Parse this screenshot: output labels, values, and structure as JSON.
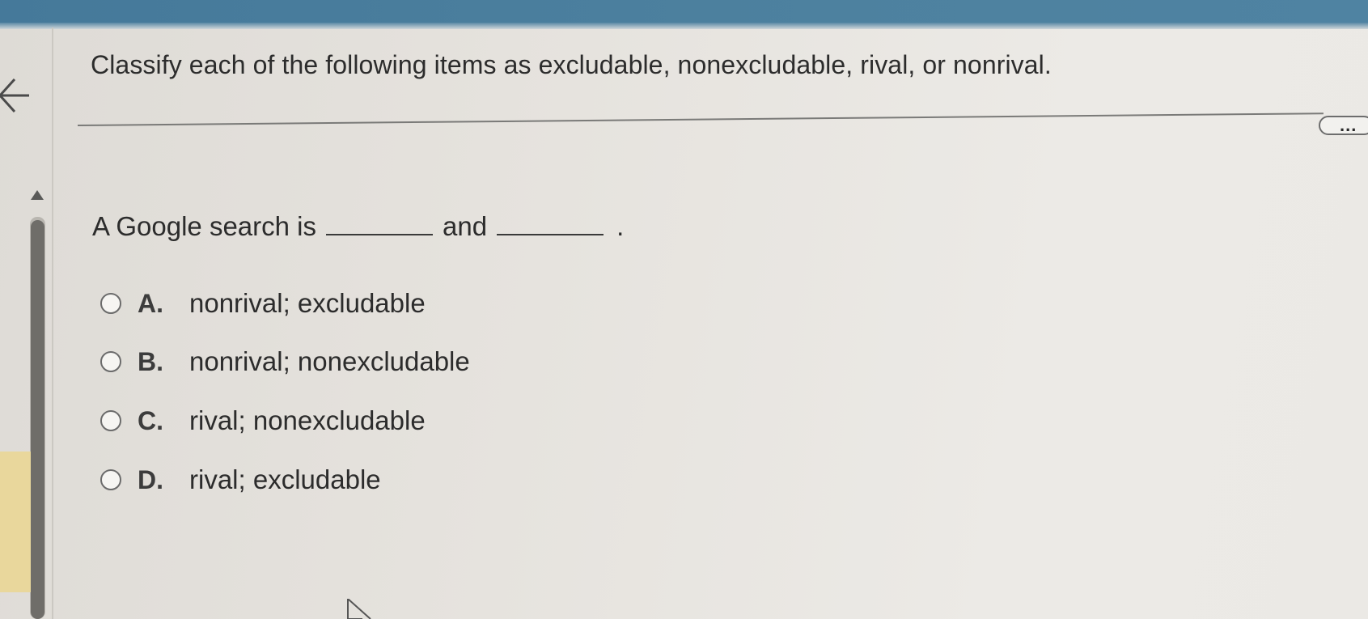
{
  "question": {
    "title": "Classify each of the following items as excludable, nonexcludable, rival, or nonrival.",
    "prompt_start": "A Google search is",
    "prompt_mid": "and",
    "prompt_end": "."
  },
  "toolbar": {
    "more_label": "..."
  },
  "options": [
    {
      "letter": "A.",
      "text": "nonrival; excludable"
    },
    {
      "letter": "B.",
      "text": "nonrival; nonexcludable"
    },
    {
      "letter": "C.",
      "text": "rival; nonexcludable"
    },
    {
      "letter": "D.",
      "text": "rival; excludable"
    }
  ],
  "colors": {
    "header_blue": "#4d819f",
    "background": "#e4e1dc",
    "highlight_tab": "#e9d79c",
    "text": "#2c2c2c"
  },
  "icons": {
    "back": "back-arrow-icon",
    "scroll_up": "triangle-up-icon",
    "cursor": "mouse-pointer-icon"
  }
}
